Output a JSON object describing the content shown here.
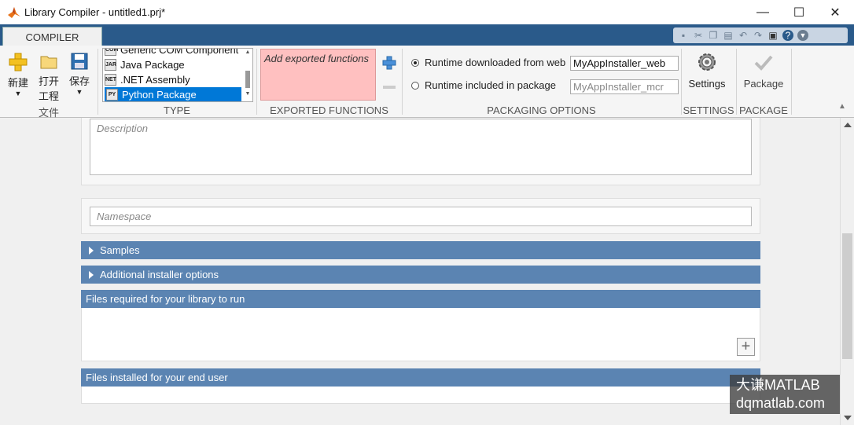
{
  "window": {
    "title": "Library Compiler - untitled1.prj*",
    "minimize": "—",
    "maximize": "☐",
    "close": "✕"
  },
  "tabs": {
    "compiler": "COMPILER"
  },
  "ribbon": {
    "file": {
      "new_label": "新建",
      "open_label_1": "打开",
      "open_label_2": "工程",
      "save_label": "保存",
      "section": "文件"
    },
    "type": {
      "section": "TYPE",
      "items": [
        {
          "icon": "COM",
          "label": "Generic COM Component"
        },
        {
          "icon": "JAR",
          "label": "Java Package"
        },
        {
          "icon": "NET",
          "label": ".NET Assembly"
        },
        {
          "icon": "PY",
          "label": "Python Package"
        }
      ]
    },
    "exported": {
      "placeholder": "Add exported functions",
      "section": "EXPORTED FUNCTIONS"
    },
    "packaging": {
      "section": "PACKAGING OPTIONS",
      "web_label": "Runtime downloaded from web",
      "web_value": "MyAppInstaller_web",
      "included_label": "Runtime included in package",
      "included_value": "MyAppInstaller_mcr"
    },
    "settings": {
      "label": "Settings",
      "section": "SETTINGS"
    },
    "package": {
      "label": "Package",
      "section": "PACKAGE"
    }
  },
  "content": {
    "description_placeholder": "Description",
    "namespace_placeholder": "Namespace",
    "samples": "Samples",
    "additional_installer": "Additional installer options",
    "files_required": "Files required for your library to run",
    "files_installed": "Files installed for your end user"
  },
  "watermark": {
    "line1": "大谦MATLAB",
    "line2": "dqmatlab.com"
  }
}
